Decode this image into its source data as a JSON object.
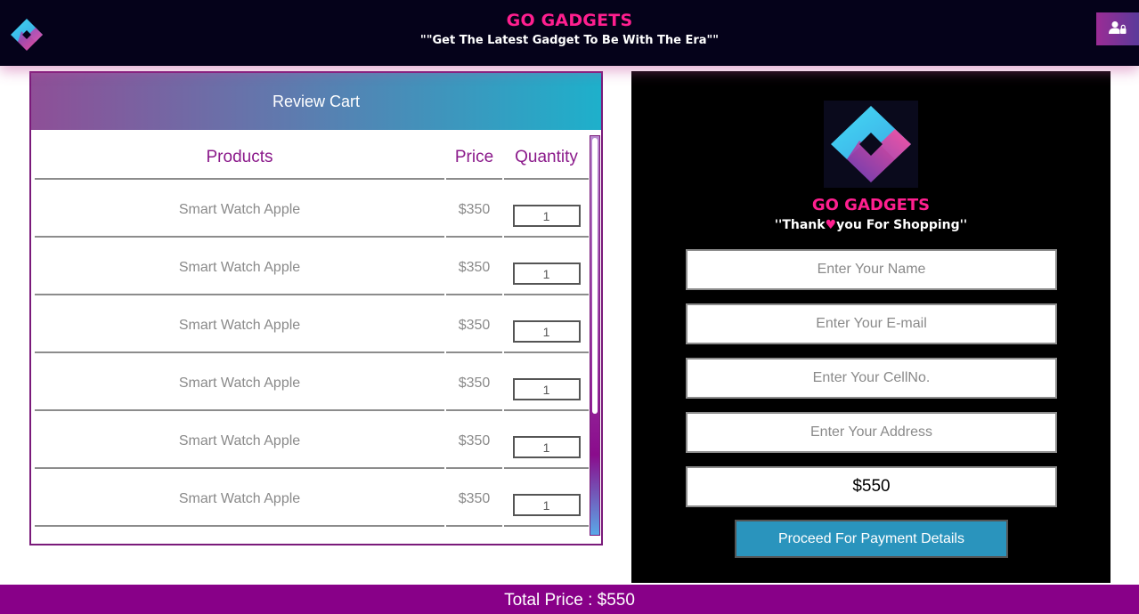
{
  "header": {
    "brand": "GO GADGETS",
    "tagline": "\"\"Get The Latest Gadget To Be With The Era\"\"",
    "logo_icon": "go-gadgets-logo",
    "user_icon": "user-lock-icon",
    "colors": {
      "background": "#05021a",
      "brand": "#ff1f8f",
      "user_button": "#9b2c95"
    }
  },
  "cart": {
    "title": "Review Cart",
    "columns": [
      "Products",
      "Price",
      "Quantity"
    ],
    "rows": [
      {
        "product": "Smart Watch Apple",
        "price": "$350",
        "quantity": "1"
      },
      {
        "product": "Smart Watch Apple",
        "price": "$350",
        "quantity": "1"
      },
      {
        "product": "Smart Watch Apple",
        "price": "$350",
        "quantity": "1"
      },
      {
        "product": "Smart Watch Apple",
        "price": "$350",
        "quantity": "1"
      },
      {
        "product": "Smart Watch Apple",
        "price": "$350",
        "quantity": "1"
      },
      {
        "product": "Smart Watch Apple",
        "price": "$350",
        "quantity": "1"
      }
    ],
    "colors": {
      "header_start": "#8e4f97",
      "header_end": "#1eb0cb",
      "border": "#7a1a7a",
      "column_text": "#8b1a8b"
    }
  },
  "checkout": {
    "brand": "GO GADGETS",
    "thanks_before": "''Thank",
    "heart": "♥",
    "thanks_after": "you For Shopping''",
    "name_placeholder": "Enter Your Name",
    "email_placeholder": "Enter Your E-mail",
    "cell_placeholder": "Enter Your CellNo.",
    "address_placeholder": "Enter Your Address",
    "total_value": "$550",
    "proceed_label": "Proceed For Payment Details",
    "colors": {
      "background": "#000000",
      "button": "#2a94bd"
    }
  },
  "footer": {
    "total_label": "Total Price : $550",
    "color": "#880088"
  }
}
